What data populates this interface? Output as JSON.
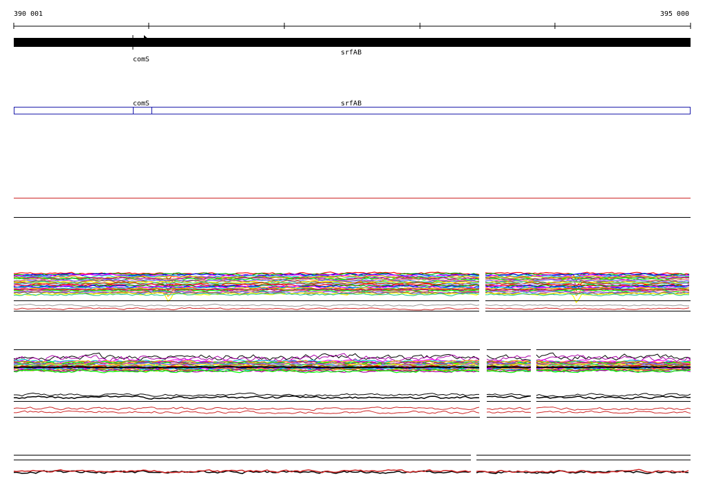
{
  "ruler": {
    "start_label": "390 001",
    "end_label": "395 000",
    "start": 390001,
    "end": 395000
  },
  "genes": [
    {
      "name": "comS",
      "start": 390880,
      "end": 391010,
      "strand": "+"
    },
    {
      "name": "srfAB",
      "start": 390001,
      "end": 395000,
      "strand": "+"
    }
  ],
  "annotation_track": {
    "labels": [
      "comS",
      "srfAB"
    ],
    "color": "#1a1aaa"
  },
  "colors": {
    "separator_red": "#cc2222",
    "axis": "#000000",
    "palette": [
      "#ff0000",
      "#00aa00",
      "#0000ff",
      "#ff00ff",
      "#00cccc",
      "#ffaa00",
      "#888800",
      "#aa00aa",
      "#00ff00",
      "#ff6699",
      "#6666ff",
      "#996633",
      "#ffff00",
      "#33cc99",
      "#cc3300",
      "#9999ff"
    ]
  }
}
